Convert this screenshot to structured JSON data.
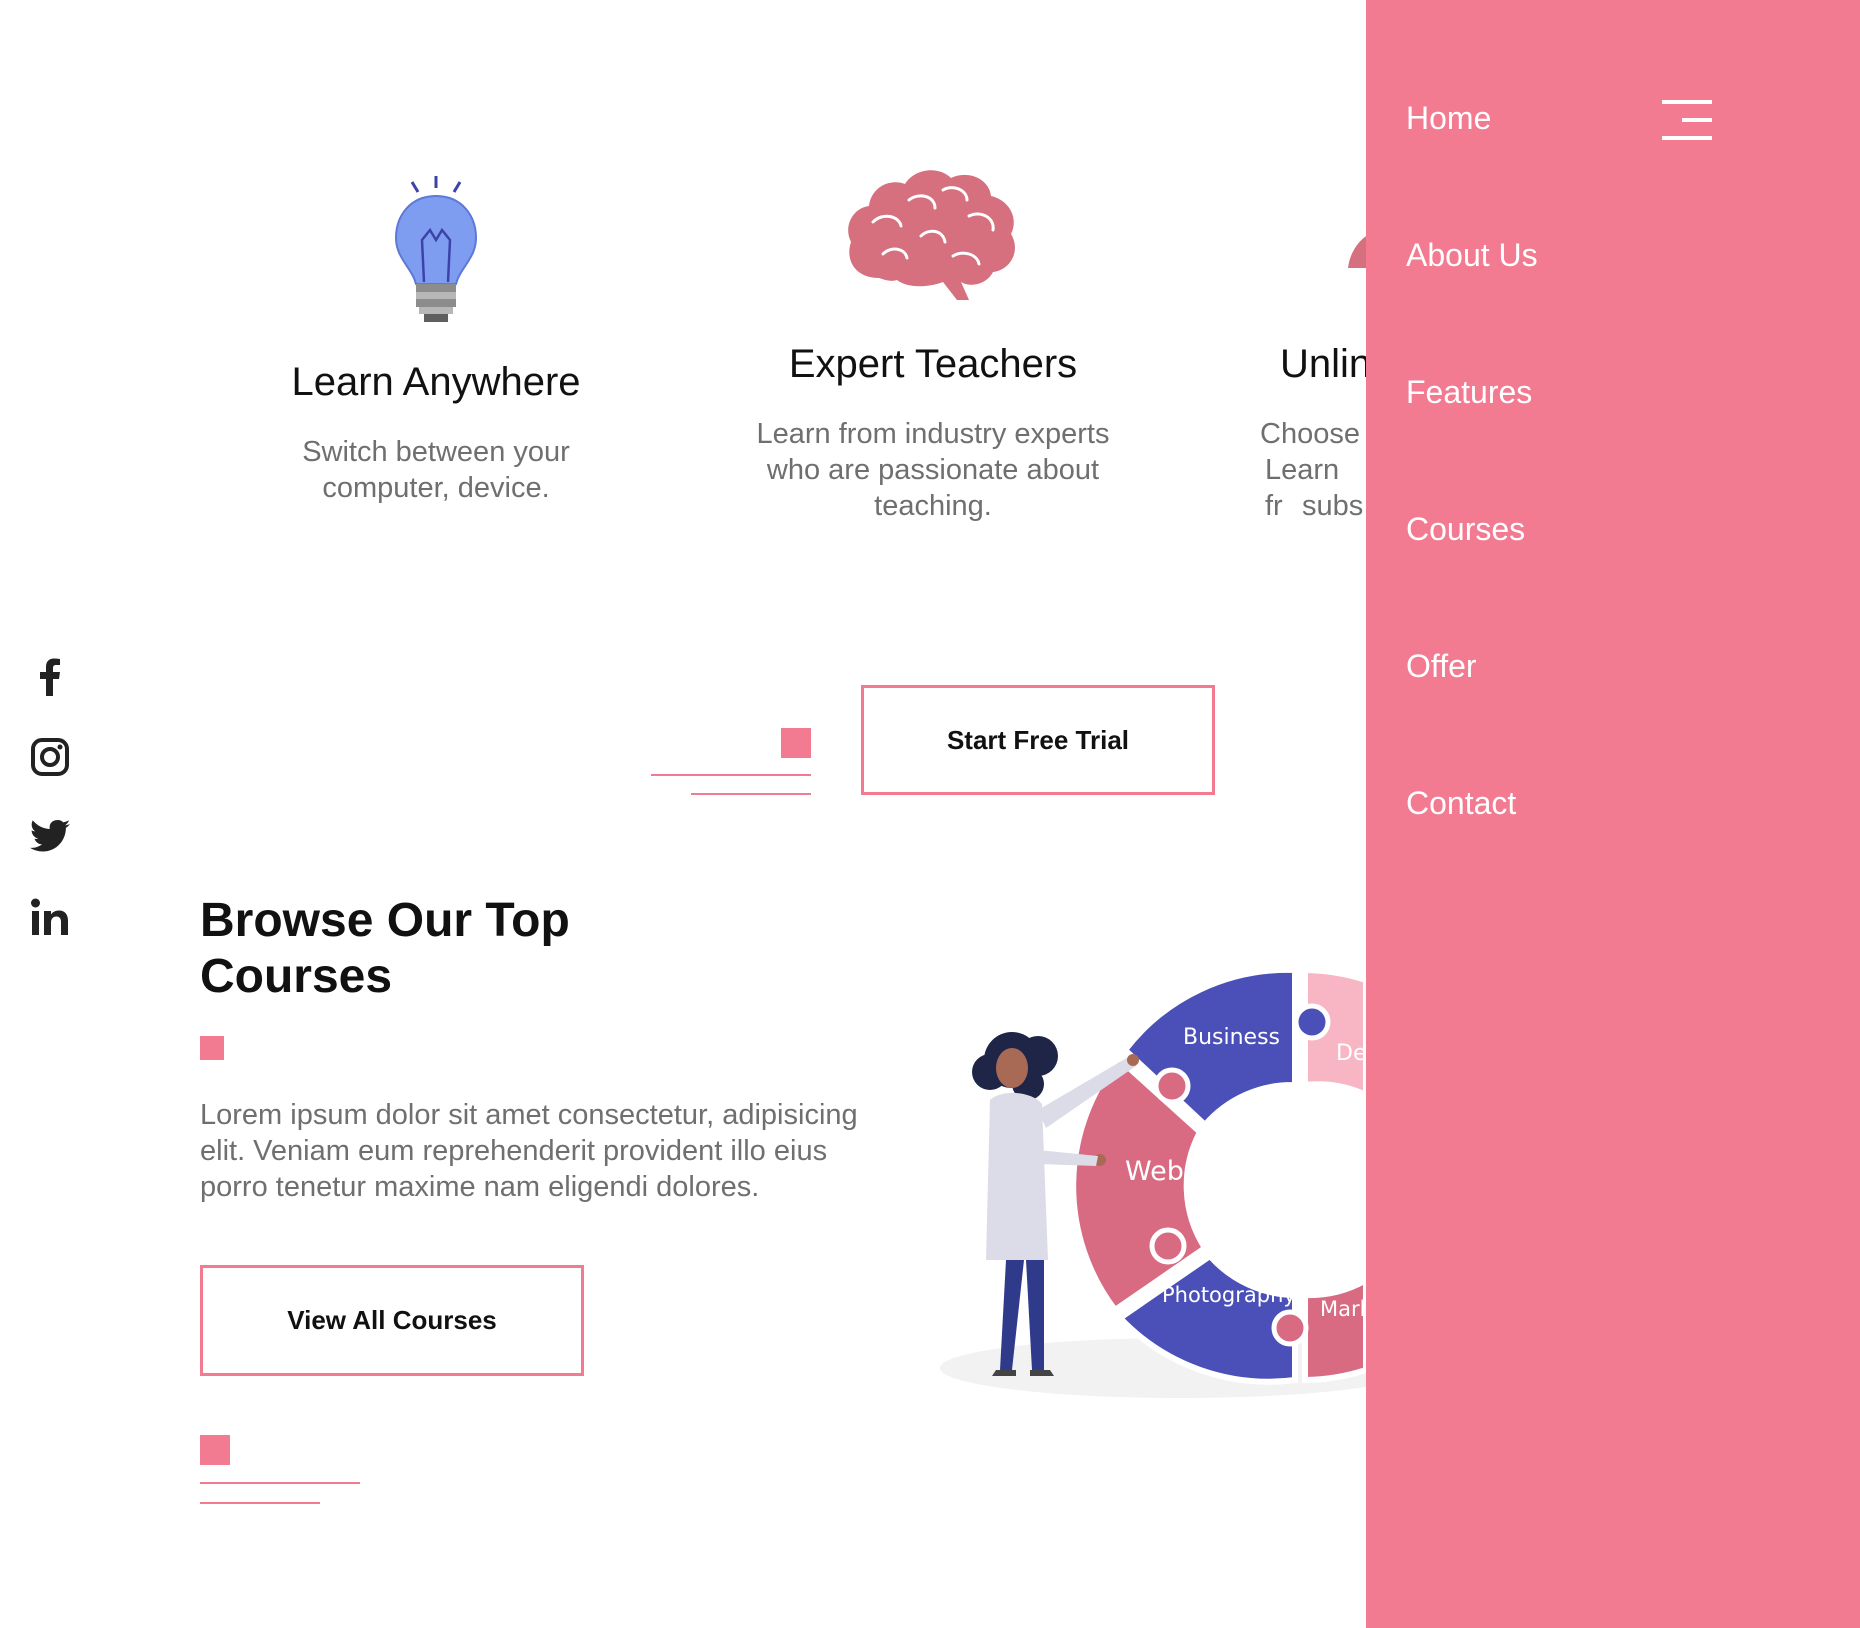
{
  "features": [
    {
      "title": "Learn Anywhere",
      "description": "Switch between your computer, device.",
      "icon": "lightbulb-icon"
    },
    {
      "title": "Expert Teachers",
      "description": "Learn from industry experts who are passionate about teaching.",
      "icon": "brain-icon"
    },
    {
      "title": "Unlin",
      "description_lines": [
        "Choose",
        "Learn fr",
        "subs"
      ],
      "icon": "partial-icon"
    }
  ],
  "cta": {
    "start_trial_label": "Start Free Trial"
  },
  "social": [
    "facebook-icon",
    "instagram-icon",
    "twitter-icon",
    "linkedin-icon"
  ],
  "courses_section": {
    "heading_line1": "Browse Our Top",
    "heading_line2": "Courses",
    "description": "Lorem ipsum dolor sit amet consectetur, adipisicing elit. Veniam eum reprehenderit provident illo eius porro tenetur maxime nam eligendi dolores.",
    "view_all_label": "View All Courses"
  },
  "illustration": {
    "segments": [
      "Business",
      "De",
      "Web",
      "Photography",
      "Mark"
    ]
  },
  "menu": {
    "items": [
      "Home",
      "About Us",
      "Features",
      "Courses",
      "Offer",
      "Contact"
    ]
  },
  "colors": {
    "accent": "#f27b92",
    "indigo": "#4a50b8",
    "pink_dark": "#d86a82",
    "pink_light": "#f8b6c5",
    "bulb": "#7f9df0",
    "brain": "#d6707f"
  }
}
